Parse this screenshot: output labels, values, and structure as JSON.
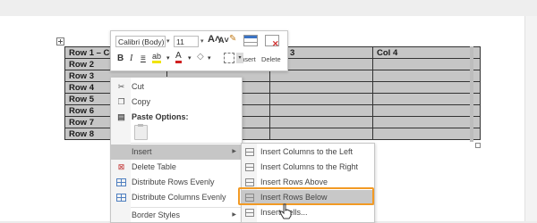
{
  "table": {
    "headers": [
      "Row 1 – Col 1",
      "",
      "Col 3",
      "Col 4"
    ],
    "rows": [
      "Row 2",
      "Row 3",
      "Row 4",
      "Row 5",
      "Row 6",
      "Row 7",
      "Row 8"
    ]
  },
  "mini_toolbar": {
    "font_name": "Calibri (Body)",
    "font_size": "11",
    "grow_label": "A˄",
    "shrink_label": "A˅",
    "bold_label": "B",
    "italic_label": "I",
    "insert_label": "Insert",
    "delete_label": "Delete"
  },
  "context_menu": {
    "cut_label": "Cut",
    "copy_label": "Copy",
    "paste_options_label": "Paste Options:",
    "insert_label": "Insert",
    "delete_table_label": "Delete Table",
    "distribute_rows_label": "Distribute Rows Evenly",
    "distribute_cols_label": "Distribute Columns Evenly",
    "border_styles_label": "Border Styles"
  },
  "submenu": {
    "items": [
      "Insert Columns to the Left",
      "Insert Columns to the Right",
      "Insert Rows Above",
      "Insert Rows Below",
      "Insert Cells..."
    ],
    "highlighted": "Insert Rows Below"
  },
  "colors": {
    "table_fill": "#c6c6c6",
    "menu_highlight": "#c6c6c6",
    "callout_orange": "#f29a24"
  }
}
